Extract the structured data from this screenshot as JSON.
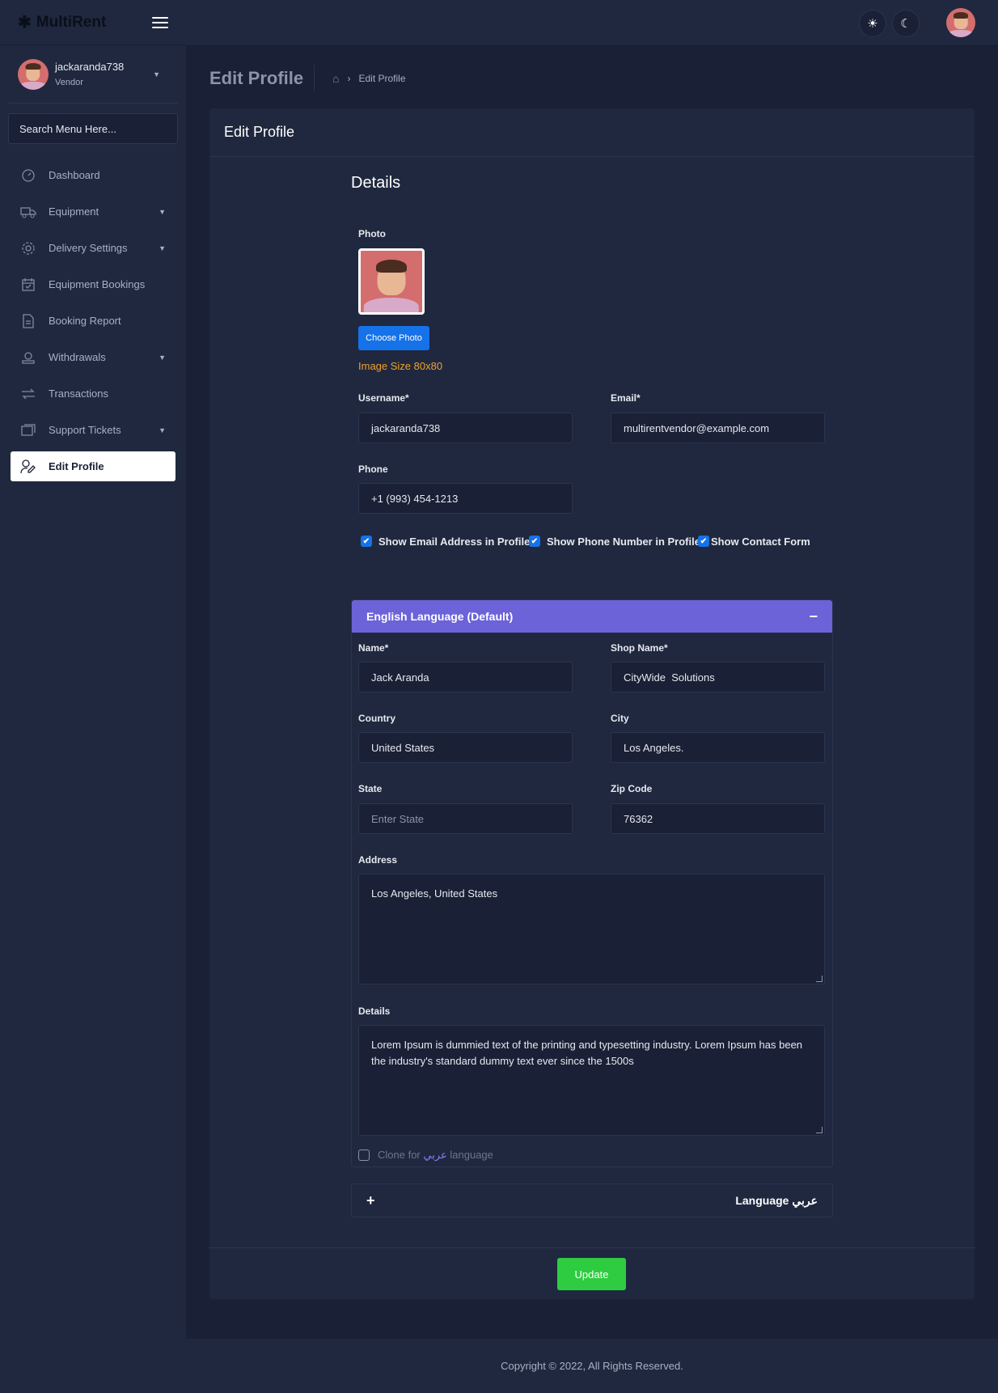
{
  "app": {
    "brand": "MultiRent"
  },
  "user": {
    "name": "jackaranda738",
    "role": "Vendor"
  },
  "sidebar": {
    "search_placeholder": "Search Menu Here...",
    "items": [
      {
        "label": "Dashboard",
        "icon": "dashboard-icon"
      },
      {
        "label": "Equipment",
        "icon": "truck-icon"
      },
      {
        "label": "Delivery Settings",
        "icon": "gear-icon"
      },
      {
        "label": "Equipment Bookings",
        "icon": "calendar-check-icon"
      },
      {
        "label": "Booking Report",
        "icon": "report-icon"
      },
      {
        "label": "Withdrawals",
        "icon": "withdraw-icon"
      },
      {
        "label": "Transactions",
        "icon": "transfer-icon"
      },
      {
        "label": "Support Tickets",
        "icon": "ticket-icon"
      },
      {
        "label": "Edit Profile",
        "icon": "user-edit-icon"
      }
    ]
  },
  "topbar": {
    "light_icon": "sun-icon",
    "dark_icon": "moon-icon"
  },
  "header": {
    "title": "Edit Profile",
    "breadcrumb": "Edit Profile"
  },
  "card": {
    "title": "Edit Profile",
    "section": "Details",
    "photo_label": "Photo",
    "choose_photo": "Choose Photo",
    "image_hint": "Image Size 80x80",
    "username_label": "Username*",
    "username": "jackaranda738",
    "email_label": "Email*",
    "email": "multirentvendor@example.com",
    "phone_label": "Phone",
    "phone": "+1 (993) 454-1213",
    "checks": [
      {
        "label": "Show Email Address in Profile Pa",
        "checked": true
      },
      {
        "label": "Show Phone Number in Profile P",
        "checked": true
      },
      {
        "label": "Show Contact Form",
        "checked": true
      }
    ],
    "update": "Update"
  },
  "lang_en": {
    "title": "English Language (Default)",
    "name_label": "Name*",
    "name": "Jack Aranda",
    "shop_label": "Shop Name*",
    "shop": "CityWide  Solutions",
    "country_label": "Country",
    "country": "United States",
    "city_label": "City",
    "city": "Los Angeles.",
    "state_label": "State",
    "state_placeholder": "Enter State",
    "zip_label": "Zip Code",
    "zip": "76362",
    "address_label": "Address",
    "address": "Los Angeles, United States",
    "details_label": "Details",
    "details": "Lorem Ipsum is dummied text of the printing and typesetting industry. Lorem Ipsum has been the industry's standard dummy text ever since the 1500s",
    "clone_prefix": "Clone for",
    "clone_lang": "عربي",
    "clone_suffix": "language"
  },
  "lang_ar": {
    "title": "Language عربي"
  },
  "footer": {
    "copyright": "Copyright © 2022, All Rights Reserved."
  },
  "colors": {
    "accent": "#6c63d9",
    "primary": "#1572e8",
    "success": "#2ecc40",
    "warning": "#f0a030"
  }
}
